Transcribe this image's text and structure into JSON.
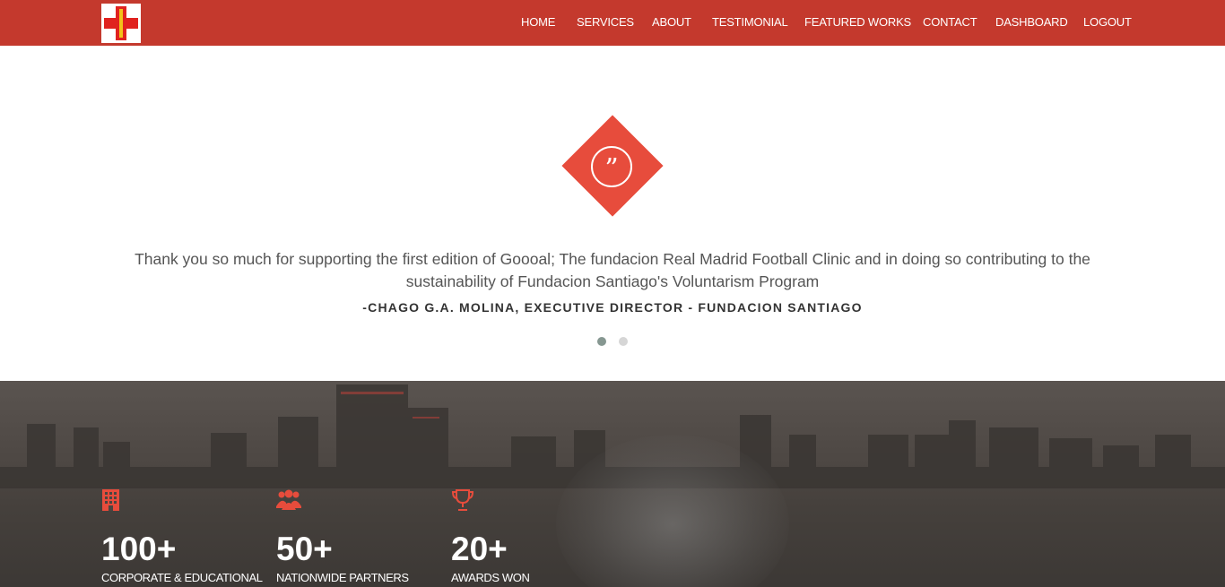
{
  "colors": {
    "nav_bg": "#c4392d",
    "accent": "#e74c3c",
    "text": "#555555"
  },
  "nav": {
    "logo_icon": "red-cross-staff-logo-icon",
    "items": [
      "HOME",
      "SERVICES",
      "ABOUT",
      "TESTIMONIAL",
      "FEATURED WORKS",
      "CONTACT",
      "DASHBOARD",
      "LOGOUT"
    ]
  },
  "testimonial": {
    "icon": "quote-icon",
    "text": "Thank you so much for supporting the first edition of Goooal; The fundacion Real Madrid Football Clinic and in doing so contributing to the sustainability of Fundacion Santiago's Voluntarism Program",
    "author": "-CHAGO G.A. MOLINA, EXECUTIVE DIRECTOR - FUNDACION SANTIAGO",
    "slide_count": 2,
    "active_slide": 1
  },
  "stats": [
    {
      "icon": "building-icon",
      "value": "100+",
      "label": "CORPORATE & EDUCATIONAL"
    },
    {
      "icon": "users-icon",
      "value": "50+",
      "label": "NATIONWIDE PARTNERS"
    },
    {
      "icon": "trophy-icon",
      "value": "20+",
      "label": "AWARDS WON"
    }
  ]
}
